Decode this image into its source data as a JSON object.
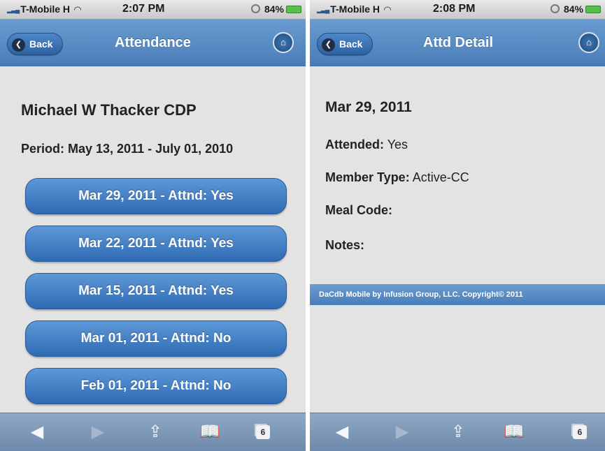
{
  "left": {
    "status": {
      "carrier": "T-Mobile H",
      "time": "2:07 PM",
      "battery": "84%"
    },
    "header": {
      "back_label": "Back",
      "title": "Attendance"
    },
    "member_name": "Michael W Thacker CDP",
    "period": "Period: May 13, 2011 - July 01, 2010",
    "attendance": [
      {
        "label": "Mar 29, 2011 - Attnd: Yes"
      },
      {
        "label": "Mar 22, 2011 - Attnd: Yes"
      },
      {
        "label": "Mar 15, 2011 - Attnd: Yes"
      },
      {
        "label": "Mar 01, 2011 - Attnd: No"
      },
      {
        "label": "Feb 01, 2011 - Attnd: No"
      }
    ],
    "toolbar": {
      "tabs_count": "6"
    }
  },
  "right": {
    "status": {
      "carrier": "T-Mobile H",
      "time": "2:08 PM",
      "battery": "84%"
    },
    "header": {
      "back_label": "Back",
      "title": "Attd Detail"
    },
    "date": "Mar 29, 2011",
    "attended": {
      "label": "Attended:",
      "value": "Yes"
    },
    "member_type": {
      "label": "Member Type:",
      "value": "Active-CC"
    },
    "meal_code": {
      "label": "Meal Code:",
      "value": ""
    },
    "notes": {
      "label": "Notes:",
      "value": ""
    },
    "footer": "DaCdb Mobile by Infusion Group, LLC.  Copyright© 2011",
    "toolbar": {
      "tabs_count": "6"
    }
  },
  "colors": {
    "header": "#5b8cc5",
    "button": "#3f7cc0",
    "background": "#e3e3e3",
    "toolbar": "#7d97b8"
  },
  "icons": [
    "signal-icon",
    "wifi-icon",
    "battery-icon",
    "chevron-left-icon",
    "home-icon",
    "back-arrow-icon",
    "forward-arrow-icon",
    "share-icon",
    "bookmarks-icon",
    "tabs-icon"
  ]
}
